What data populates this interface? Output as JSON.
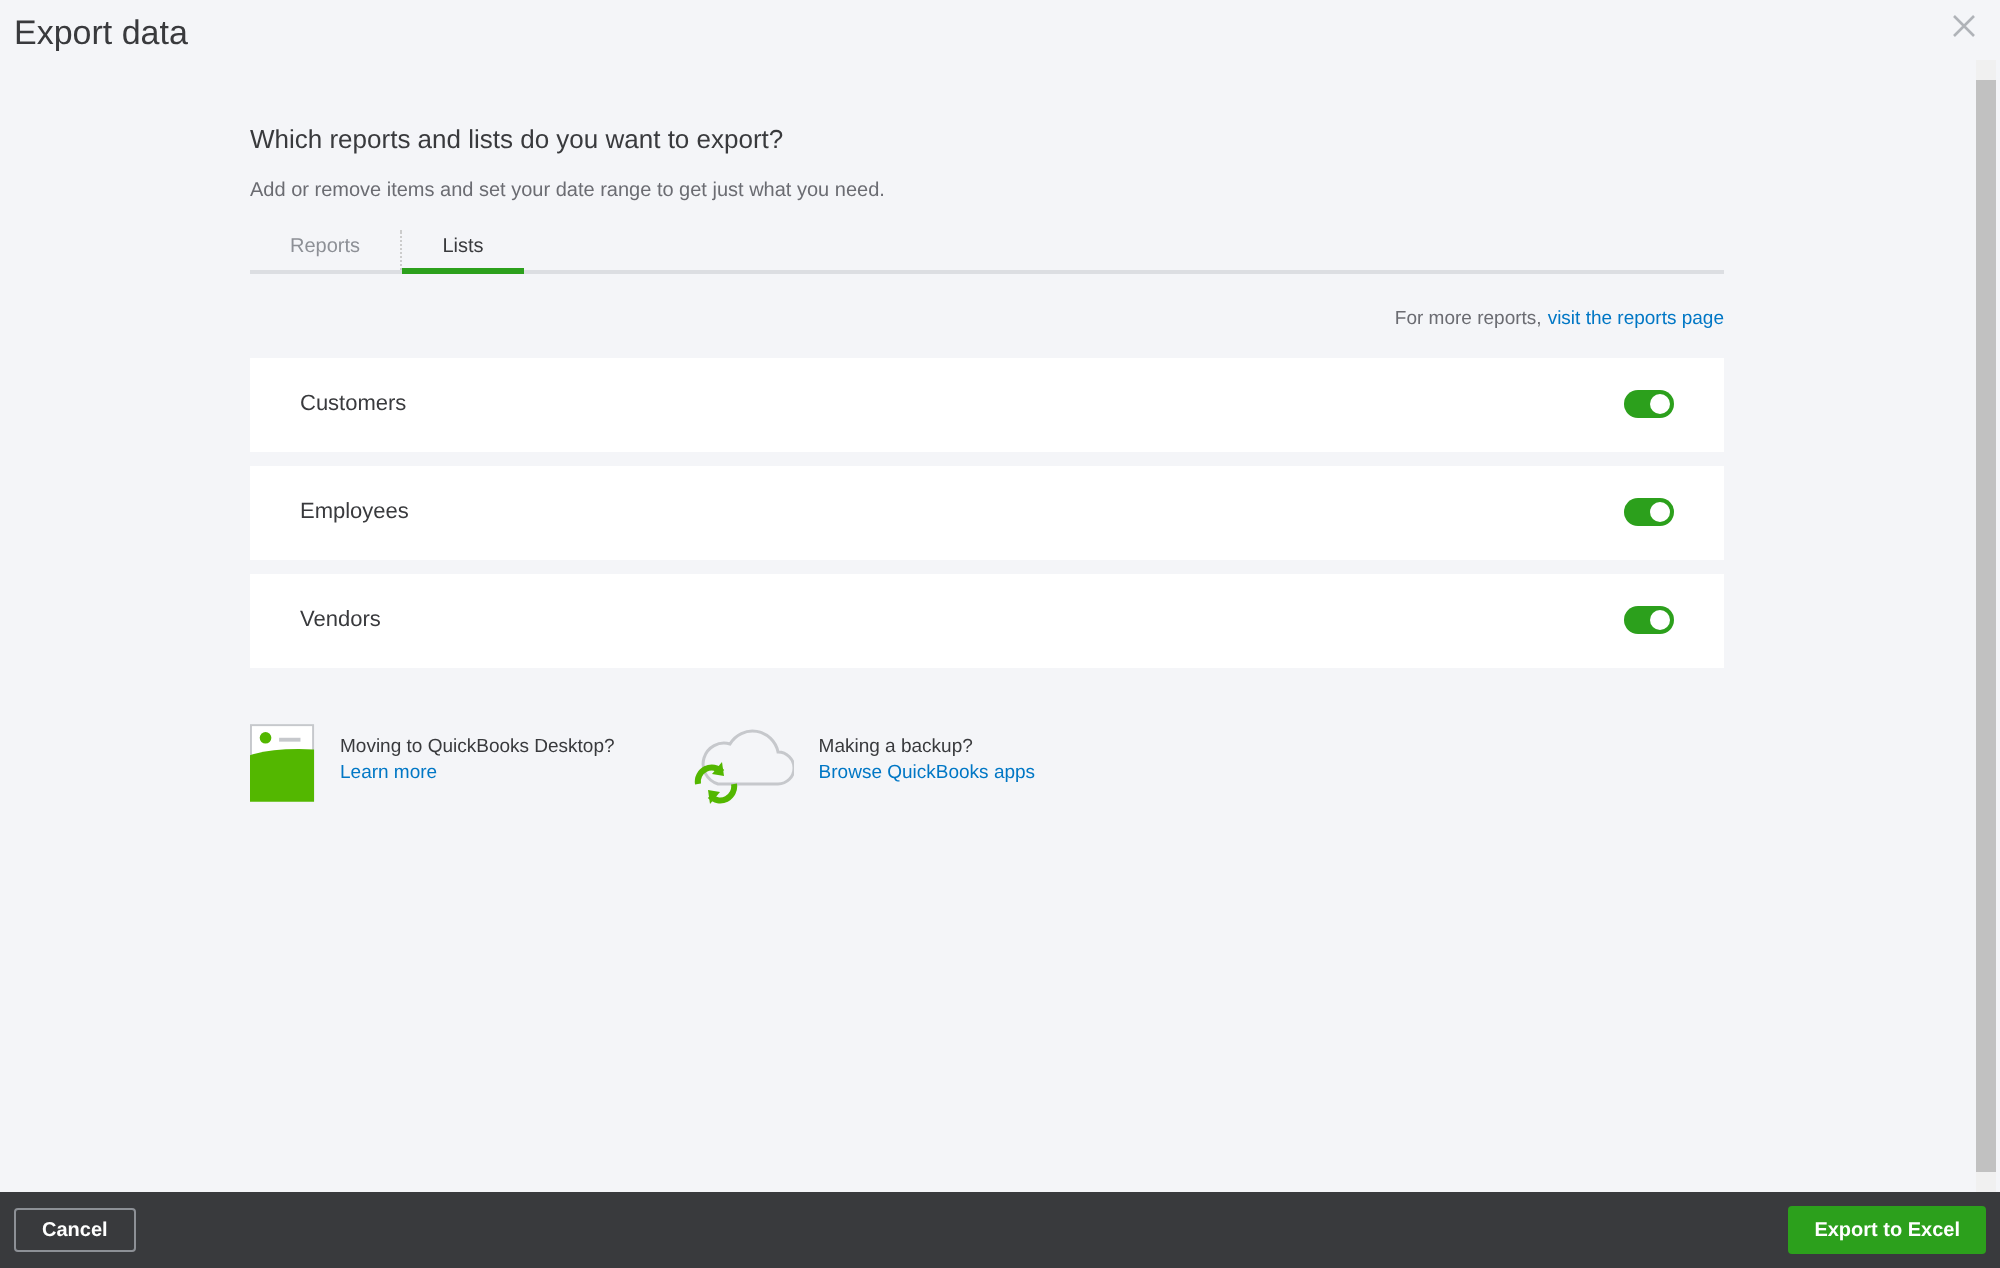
{
  "window": {
    "title": "Export data"
  },
  "heading": "Which reports and lists do you want to export?",
  "subheading": "Add or remove items and set your date range to get just what you need.",
  "tabs": [
    {
      "label": "Reports",
      "selected": false
    },
    {
      "label": "Lists",
      "selected": true
    }
  ],
  "more_reports": {
    "text": "For more reports,",
    "link": "visit the reports page"
  },
  "lists": [
    {
      "name": "Customers",
      "on": true
    },
    {
      "name": "Employees",
      "on": true
    },
    {
      "name": "Vendors",
      "on": true
    }
  ],
  "promos": [
    {
      "kind": "desktop",
      "title": "Moving to QuickBooks Desktop?",
      "link": "Learn more"
    },
    {
      "kind": "backup",
      "title": "Making a backup?",
      "link": "Browse QuickBooks apps"
    }
  ],
  "footer": {
    "cancel": "Cancel",
    "export": "Export to Excel"
  }
}
